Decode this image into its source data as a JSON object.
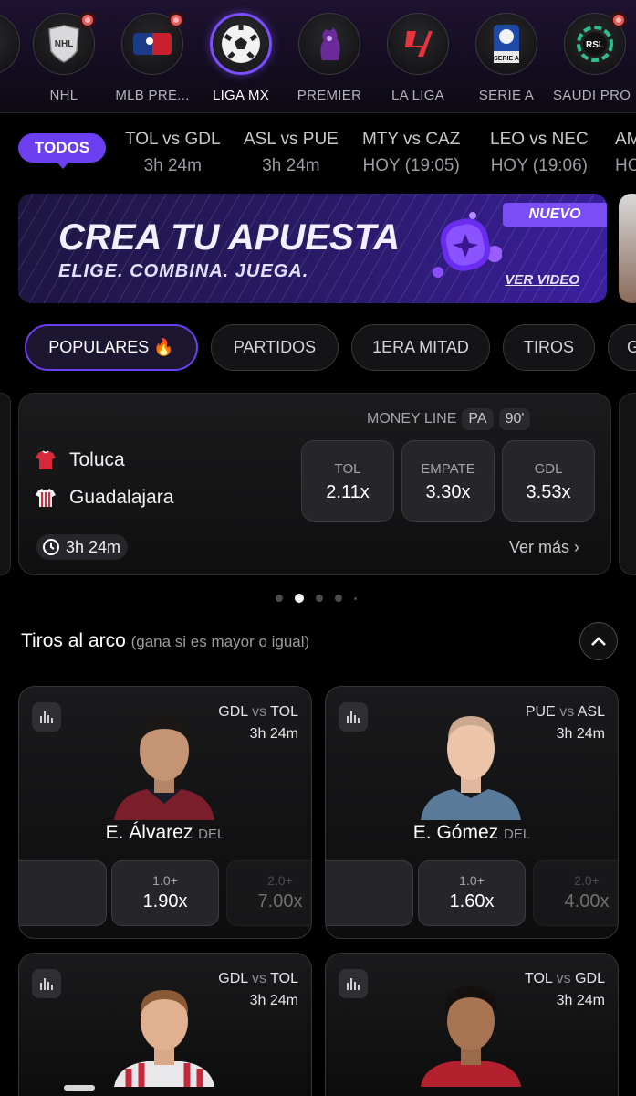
{
  "leagues": [
    {
      "label": "",
      "icon": "league-partial-icon"
    },
    {
      "label": "NHL",
      "icon": "nhl-logo",
      "live": true
    },
    {
      "label": "MLB PRE...",
      "icon": "mlb-logo",
      "live": true
    },
    {
      "label": "LIGA MX",
      "icon": "soccer-ball-icon",
      "active": true
    },
    {
      "label": "PREMIER",
      "icon": "premier-league-logo"
    },
    {
      "label": "LA LIGA",
      "icon": "laliga-logo"
    },
    {
      "label": "SERIE A",
      "icon": "serie-a-logo",
      "badge_text": "SERIE A"
    },
    {
      "label": "SAUDI PRO",
      "icon": "saudi-pro-league-logo",
      "badge_text": "RSL",
      "live": true
    }
  ],
  "matches_filter": {
    "all_label": "TODOS",
    "matches": [
      {
        "teams": "TOL vs GDL",
        "status": "3h 24m"
      },
      {
        "teams": "ASL vs PUE",
        "status": "3h 24m"
      },
      {
        "teams": "MTY vs CAZ",
        "status": "HOY (19:05)"
      },
      {
        "teams": "LEO vs NEC",
        "status": "HOY (19:06)"
      },
      {
        "teams": "AM",
        "status": "HO"
      }
    ]
  },
  "banner": {
    "title": "CREA TU APUESTA",
    "subtitle": "ELIGE. COMBINA. JUEGA.",
    "badge": "NUEVO",
    "link": "VER VIDEO"
  },
  "market_tabs": [
    "POPULARES 🔥",
    "PARTIDOS",
    "1ERA MITAD",
    "TIROS",
    "G"
  ],
  "match_card": {
    "market_label": "MONEY LINE",
    "tags": [
      "PA",
      "90'"
    ],
    "home_team": "Toluca",
    "away_team": "Guadalajara",
    "odds": [
      {
        "label": "TOL",
        "value": "2.11x"
      },
      {
        "label": "EMPATE",
        "value": "3.30x"
      },
      {
        "label": "GDL",
        "value": "3.53x"
      }
    ],
    "time_left": "3h 24m",
    "more_link": "Ver más",
    "colors": {
      "home_shirt": "#d62a3a",
      "away_shirt": "#d62a3a"
    }
  },
  "carousel": {
    "count": 5,
    "active_index": 1
  },
  "section": {
    "title": "Tiros al arco",
    "subtitle": "(gana si es mayor o igual)"
  },
  "players": [
    {
      "home": "GDL",
      "away": "TOL",
      "vs": "vs",
      "time": "3h 24m",
      "name": "E. Álvarez",
      "pos": "DEL",
      "lines": [
        {
          "k": "",
          "v": ""
        },
        {
          "k": "1.0+",
          "v": "1.90x"
        },
        {
          "k": "2.0+",
          "v": "7.00x"
        }
      ]
    },
    {
      "home": "PUE",
      "away": "ASL",
      "vs": "vs",
      "time": "3h 24m",
      "name": "E. Gómez",
      "pos": "DEL",
      "lines": [
        {
          "k": "",
          "v": ""
        },
        {
          "k": "1.0+",
          "v": "1.60x"
        },
        {
          "k": "2.0+",
          "v": "4.00x"
        }
      ]
    },
    {
      "home": "GDL",
      "away": "TOL",
      "vs": "vs",
      "time": "3h 24m",
      "name": "",
      "pos": "",
      "lines": []
    },
    {
      "home": "TOL",
      "away": "GDL",
      "vs": "vs",
      "time": "3h 24m",
      "name": "",
      "pos": "",
      "lines": []
    }
  ],
  "theme": {
    "accent": "#6c3ff0",
    "background": "#000000",
    "card": "#1a1a1c"
  }
}
